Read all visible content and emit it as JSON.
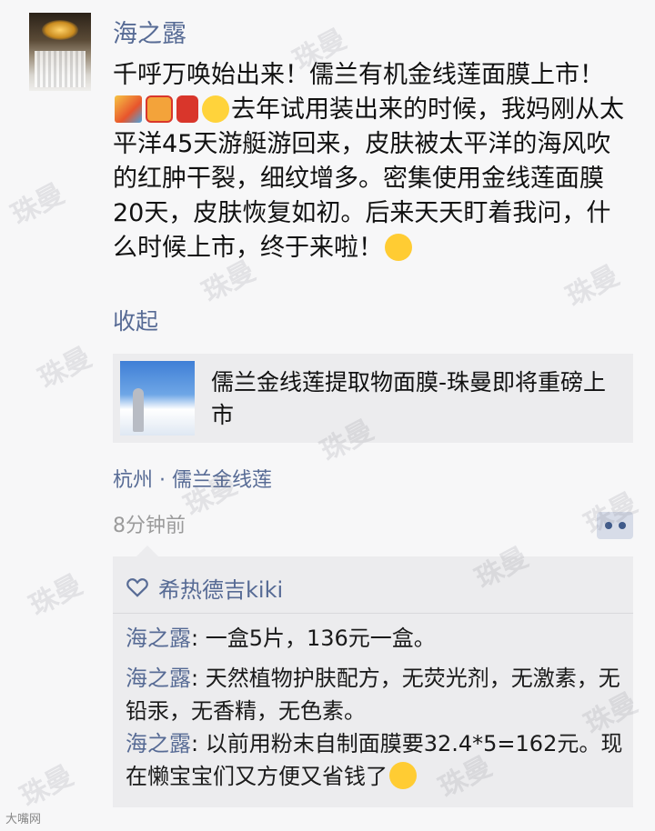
{
  "post": {
    "author": "海之露",
    "text_parts": [
      "千呼万唤始出来！儒兰有机金线莲面膜上市！",
      "去年试用装出来的时候，我妈刚从太平洋45天游艇游回来，皮肤被太平洋的海风吹的红肿干裂，细纹增多。密集使用金线莲面膜20天，皮肤恢复如初。后来天天盯着我问，什么时候上市，终于来啦！"
    ],
    "collapse_label": "收起",
    "link_card": {
      "title": "儒兰金线莲提取物面膜-珠曼即将重磅上市"
    },
    "location": "杭州 · 儒兰金线莲",
    "time": "8分钟前"
  },
  "comments": {
    "liked_by": "希热德吉kiki",
    "items": [
      {
        "name": "海之露",
        "separator": ": ",
        "text": "一盒5片，136元一盒。"
      },
      {
        "name": "海之露",
        "separator": ": ",
        "text": "天然植物护肤配方，无荧光剂，无激素，无铅汞，无香精，无色素。"
      },
      {
        "name": "海之露",
        "separator": ": ",
        "text": "以前用粉末自制面膜要32.4*5=162元。现在懒宝宝们又方便又省钱了"
      }
    ]
  },
  "watermark": "珠曼",
  "source_mark": "大嘴网",
  "icons": {
    "post_emojis": [
      "party-popper-icon",
      "gift-icon",
      "red-packet-icon",
      "chick-icon"
    ],
    "end_emoji": "grinning-face-icon",
    "comment_end_emoji": "grinning-face-icon",
    "like_icon": "heart-outline-icon",
    "more_icon": "more-dots-icon"
  },
  "colors": {
    "link_blue": "#576b95",
    "card_bg": "#ececee",
    "page_bg": "#f7f7f8"
  }
}
